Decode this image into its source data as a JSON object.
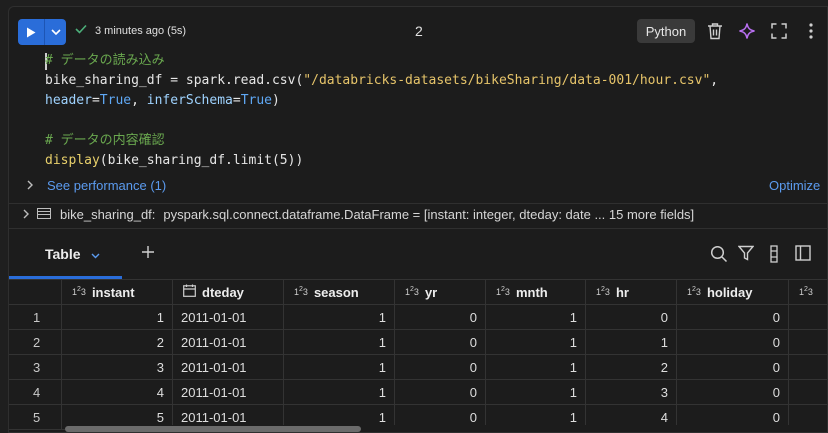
{
  "toolbar": {
    "status": "3 minutes ago (5s)",
    "cell_number": "2",
    "language": "Python"
  },
  "code": {
    "line1": "# データの読み込み",
    "line2_var": "bike_sharing_df",
    "line2_eq": " = ",
    "line2_call": "spark.read.csv(",
    "line2_str": "\"/databricks-datasets/bikeSharing/data-001/hour.csv\"",
    "line2_tail": ",",
    "line3_p1": "header",
    "line3_eq1": "=",
    "line3_v1": "True",
    "line3_sep": ", ",
    "line3_p2": "inferSchema",
    "line3_eq2": "=",
    "line3_v2": "True",
    "line3_tail": ")",
    "line5": "# データの内容確認",
    "line6_func": "display",
    "line6_rest": "(bike_sharing_df.limit(5))"
  },
  "performance": {
    "link": "See performance (1)",
    "optimize": "Optimize"
  },
  "dataframe": {
    "name": "bike_sharing_df:",
    "type": "pyspark.sql.connect.dataframe.DataFrame = [instant: integer, dteday: date ... 15 more fields]"
  },
  "results": {
    "tab_label": "Table"
  },
  "table": {
    "columns": [
      "instant",
      "dteday",
      "season",
      "yr",
      "mnth",
      "hr",
      "holiday"
    ],
    "rows": [
      {
        "idx": "1",
        "instant": "1",
        "dteday": "2011-01-01",
        "season": "1",
        "yr": "0",
        "mnth": "1",
        "hr": "0",
        "holiday": "0"
      },
      {
        "idx": "2",
        "instant": "2",
        "dteday": "2011-01-01",
        "season": "1",
        "yr": "0",
        "mnth": "1",
        "hr": "1",
        "holiday": "0"
      },
      {
        "idx": "3",
        "instant": "3",
        "dteday": "2011-01-01",
        "season": "1",
        "yr": "0",
        "mnth": "1",
        "hr": "2",
        "holiday": "0"
      },
      {
        "idx": "4",
        "instant": "4",
        "dteday": "2011-01-01",
        "season": "1",
        "yr": "0",
        "mnth": "1",
        "hr": "3",
        "holiday": "0"
      },
      {
        "idx": "5",
        "instant": "5",
        "dteday": "2011-01-01",
        "season": "1",
        "yr": "0",
        "mnth": "1",
        "hr": "4",
        "holiday": "0"
      }
    ]
  },
  "colors": {
    "accent": "#2a6dd9",
    "link": "#5b9bef",
    "background": "#1c1c1c"
  }
}
